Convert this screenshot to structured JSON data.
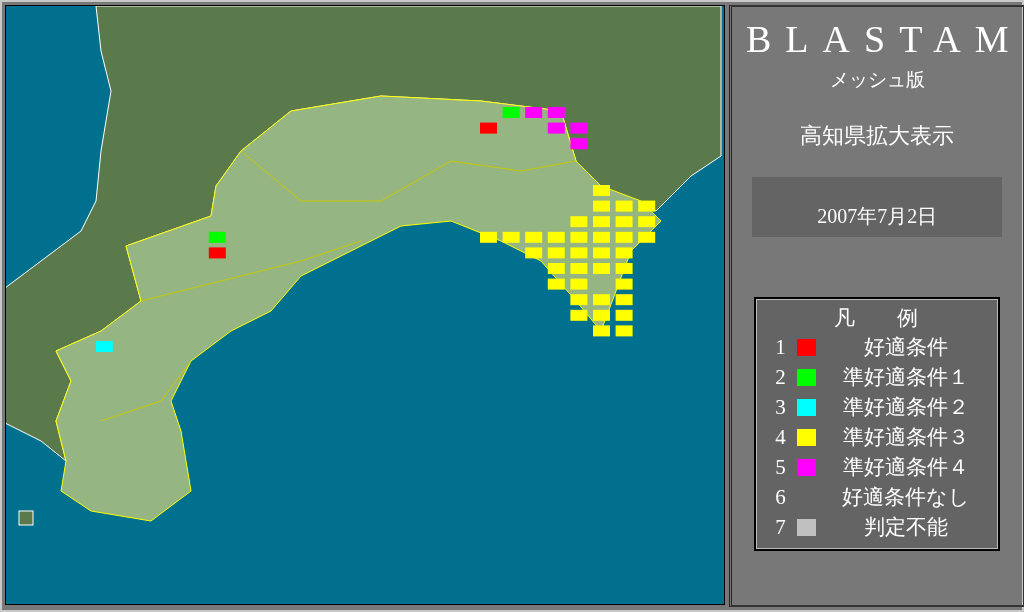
{
  "title": "BLASTAM",
  "subtitle": "メッシュ版",
  "region": "高知県拡大表示",
  "date": "2007年7月2日",
  "legend": {
    "title": "凡　　例",
    "items": [
      {
        "number": "1",
        "label": "好適条件",
        "color": "#ff0000"
      },
      {
        "number": "2",
        "label": "準好適条件１",
        "color": "#00ff00"
      },
      {
        "number": "3",
        "label": "準好適条件２",
        "color": "#00ffff"
      },
      {
        "number": "4",
        "label": "準好適条件３",
        "color": "#ffff00"
      },
      {
        "number": "5",
        "label": "準好適条件４",
        "color": "#ff00ff"
      },
      {
        "number": "6",
        "label": "好適条件なし"
      },
      {
        "number": "7",
        "label": "判定不能",
        "color": "#c0c0c0"
      }
    ]
  }
}
